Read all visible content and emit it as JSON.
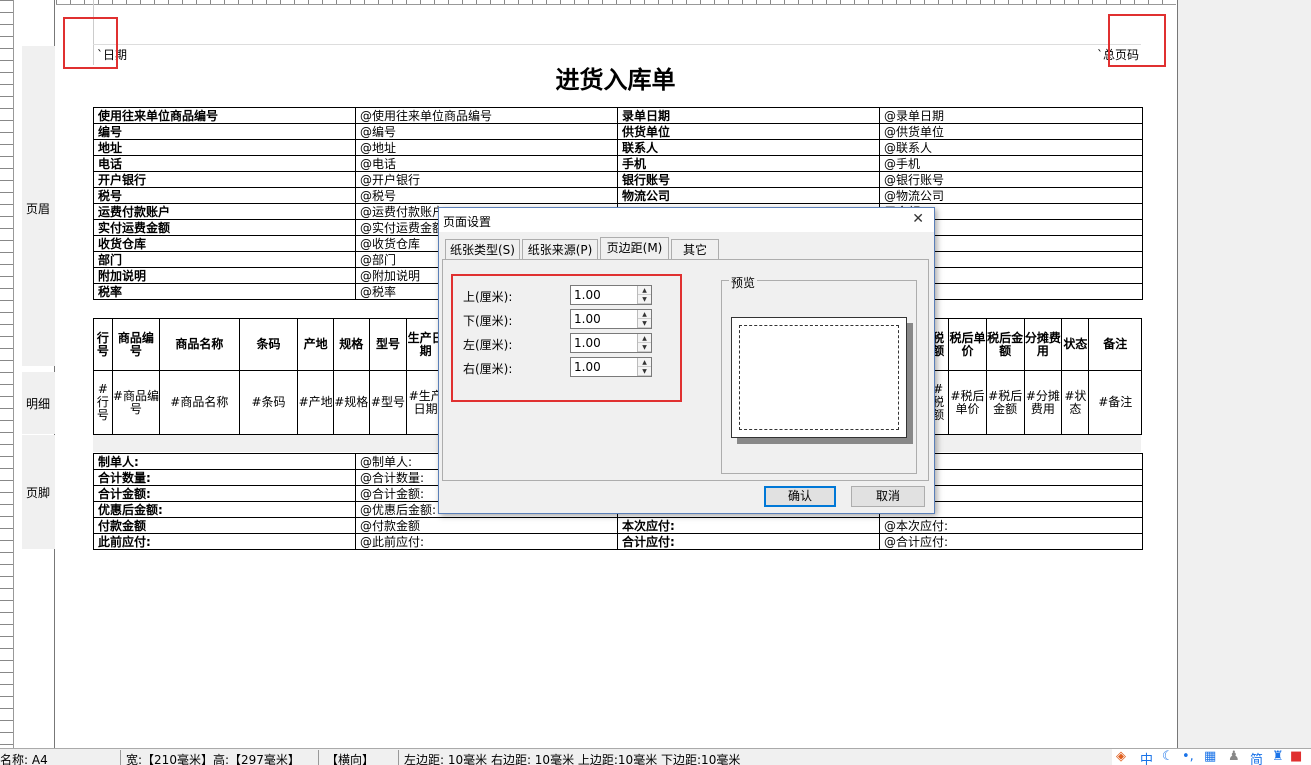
{
  "page_header": {
    "date_field": "`日期",
    "page_field": "`总页码"
  },
  "report_title": "进货入库单",
  "bands": {
    "header": "页眉",
    "detail": "明细",
    "footer": "页脚"
  },
  "info_rows": [
    [
      "使用往来单位商品编号",
      "@使用往来单位商品编号",
      "录单日期",
      "@录单日期"
    ],
    [
      "编号",
      "@编号",
      "供货单位",
      "@供货单位"
    ],
    [
      "地址",
      "@地址",
      "联系人",
      "@联系人"
    ],
    [
      "电话",
      "@电话",
      "手机",
      "@手机"
    ],
    [
      "开户银行",
      "@开户银行",
      "银行账号",
      "@银行账号"
    ],
    [
      "税号",
      "@税号",
      "物流公司",
      "@物流公司"
    ],
    [
      "运费付款账户",
      "@运费付款账户",
      "",
      "用金额"
    ],
    [
      "实付运费金额",
      "@实付运费金额",
      "",
      "用金额"
    ],
    [
      "收货仓库",
      "@收货仓库",
      "",
      ""
    ],
    [
      "部门",
      "@部门",
      "",
      ""
    ],
    [
      "附加说明",
      "@附加说明",
      "",
      "型"
    ],
    [
      "税率",
      "@税率",
      "",
      ""
    ]
  ],
  "detail_headers": [
    "行号",
    "商品编号",
    "商品名称",
    "条码",
    "产地",
    "规格",
    "型号",
    "生产日期",
    "",
    "",
    "税额",
    "税后单价",
    "税后金额",
    "分摊费用",
    "状态",
    "备注"
  ],
  "detail_cells": [
    "#行号",
    "#商品编号",
    "#商品名称",
    "#条码",
    "#产地",
    "#规格",
    "#型号",
    "#生产日期",
    "",
    "",
    "#税额",
    "#税后单价",
    "#税后金额",
    "#分摊费用",
    "#状态",
    "#备注"
  ],
  "footer_rows": [
    [
      "制单人:",
      "@制单人:",
      "",
      "理:"
    ],
    [
      "合计数量:",
      "@合计数量:",
      "",
      "计金额:"
    ],
    [
      "合计金额:",
      "@合计金额:",
      "",
      "额"
    ],
    [
      "优惠后金额:",
      "@优惠后金额:",
      "",
      ""
    ],
    [
      "付款金额",
      "@付款金额",
      "本次应付:",
      "@本次应付:"
    ],
    [
      "此前应付:",
      "@此前应付:",
      "合计应付:",
      "@合计应付:"
    ]
  ],
  "dialog": {
    "title": "页面设置",
    "tabs": [
      "纸张类型(S)",
      "纸张来源(P)",
      "页边距(M)",
      "其它"
    ],
    "active_tab": "页边距(M)",
    "fields": [
      {
        "label": "上(厘米):",
        "value": "1.00"
      },
      {
        "label": "下(厘米):",
        "value": "1.00"
      },
      {
        "label": "左(厘米):",
        "value": "1.00"
      },
      {
        "label": "右(厘米):",
        "value": "1.00"
      }
    ],
    "preview_label": "预览",
    "ok": "确认",
    "cancel": "取消"
  },
  "status": {
    "paper_name": "名称: A4",
    "size": "宽:【210毫米】高:【297毫米】",
    "orientation": "【横向】",
    "margins": "左边距: 10毫米 右边距: 10毫米 上边距:10毫米 下边距:10毫米"
  },
  "tray": {
    "ime_cn": "中",
    "ime_simplified": "简"
  },
  "colors": {
    "highlight": "#e03030",
    "dialog_border": "#5a7fb8"
  }
}
